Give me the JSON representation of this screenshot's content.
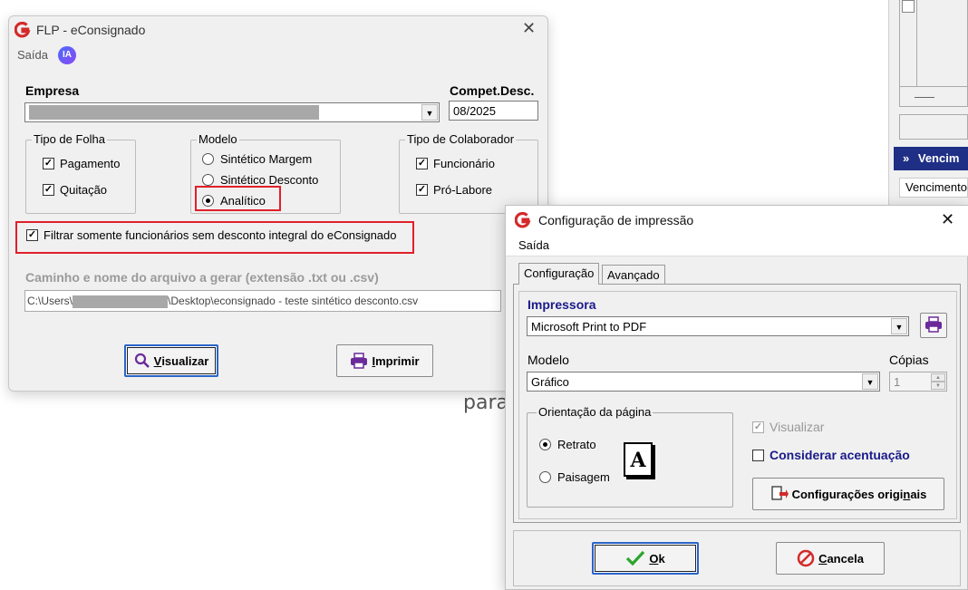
{
  "background": {
    "blue_bar_label": "Vencim",
    "row_label": "Vencimento",
    "text_fragment": "para"
  },
  "win1": {
    "title": "FLP - eConsignado",
    "menu": {
      "saida": "Saída",
      "ia": "IA"
    },
    "empresa_label": "Empresa",
    "compet_label": "Compet.Desc.",
    "compet_value": "08/2025",
    "tipo_folha": {
      "title": "Tipo de Folha",
      "items": [
        {
          "label": "Pagamento",
          "checked": true
        },
        {
          "label": "Quitação",
          "checked": true
        }
      ]
    },
    "modelo": {
      "title": "Modelo",
      "items": [
        {
          "label": "Sintético Margem",
          "selected": false
        },
        {
          "label": "Sintético Desconto",
          "selected": false
        },
        {
          "label": "Analítico",
          "selected": true
        }
      ]
    },
    "tipo_colab": {
      "title": "Tipo de Colaborador",
      "items": [
        {
          "label": "Funcionário",
          "checked": true
        },
        {
          "label": "Pró-Labore",
          "checked": true
        }
      ]
    },
    "filtrar_label": "Filtrar somente funcionários sem desconto integral do eConsignado",
    "caminho_label": "Caminho e nome do arquivo a gerar (extensão .txt ou .csv)",
    "path_prefix": "C:\\Users\\",
    "path_suffix": "\\Desktop\\econsignado - teste sintético desconto.csv",
    "visualizar_first": "V",
    "visualizar_rest": "isualizar",
    "imprimir_first": "I",
    "imprimir_rest": "mprimir"
  },
  "win2": {
    "title": "Configuração de impressão",
    "menu_saida": "Saída",
    "tabs": [
      "Configuração",
      "Avançado"
    ],
    "impressora_label": "Impressora",
    "impressora_value": "Microsoft Print to PDF",
    "modelo_label": "Modelo",
    "modelo_value": "Gráfico",
    "copias_label": "Cópias",
    "copias_value": "1",
    "orientacao_title": "Orientação da página",
    "retrato": "Retrato",
    "paisagem": "Paisagem",
    "doc_glyph": "A",
    "visualizar": "Visualizar",
    "considerar": "Considerar acentuação",
    "config_orig_pre": "Configurações origi",
    "config_orig_u": "n",
    "config_orig_post": "ais",
    "ok_first": "O",
    "ok_rest": "k",
    "cancela_first": "C",
    "cancela_rest": "ancela"
  },
  "colors": {
    "brand_red": "#d42a2a",
    "highlight_red": "#e0202a",
    "printer_purple": "#6a2a9a",
    "ok_green": "#2aa52a",
    "header_blue": "#1f2f86"
  }
}
